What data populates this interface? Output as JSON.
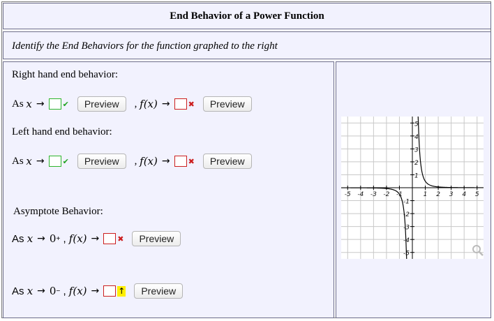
{
  "title": "End Behavior of a Power Function",
  "instruction": "Identify the End Behaviors for the function graphed to the right",
  "right_end": {
    "heading": "Right hand end behavior:",
    "as_x": "As",
    "x_var": "x",
    "fx": "f(x)",
    "preview1": "Preview",
    "preview2": "Preview",
    "status1": "correct",
    "status2": "incorrect"
  },
  "left_end": {
    "heading": "Left hand end behavior:",
    "as_x": "As",
    "x_var": "x",
    "fx": "f(x)",
    "preview1": "Preview",
    "preview2": "Preview",
    "status1": "correct",
    "status2": "incorrect"
  },
  "asymptote": {
    "heading": "Asymptote Behavior:",
    "row1": {
      "as_x": "As",
      "x_var": "x",
      "limit": "0",
      "side": "+",
      "fx": "f(x)",
      "preview": "Preview",
      "status": "incorrect"
    },
    "row2": {
      "as_x": "As",
      "x_var": "x",
      "limit": "0",
      "side": "−",
      "fx": "f(x)",
      "preview": "Preview",
      "status": "warning"
    }
  },
  "graph": {
    "x_ticks": [
      "-5",
      "-4",
      "-3",
      "-2",
      "-1",
      "1",
      "2",
      "3",
      "4",
      "5"
    ],
    "y_ticks_pos": [
      "5",
      "4",
      "3",
      "2",
      "1"
    ],
    "y_ticks_neg": [
      "-1",
      "-2",
      "-3",
      "-4",
      "-5"
    ],
    "xlim": [
      -5.5,
      5.5
    ],
    "ylim": [
      -5.5,
      5.5
    ],
    "zoom_icon": "magnifier-icon"
  }
}
